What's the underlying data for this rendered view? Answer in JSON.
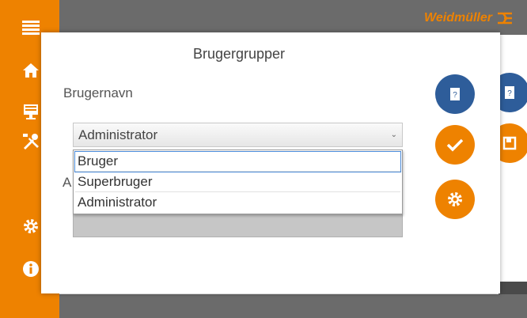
{
  "brand": {
    "name": "Weidmüller"
  },
  "dialog": {
    "title": "Brugergrupper",
    "username_label": "Brugernavn",
    "second_label_visible": "A"
  },
  "select": {
    "value": "Administrator",
    "options": [
      "Bruger",
      "Superbruger",
      "Administrator"
    ],
    "highlighted": "Bruger"
  },
  "colors": {
    "accent_orange": "#ee8200",
    "button_blue": "#2e5d9a",
    "bar_gray": "#6b6b6b"
  },
  "icons": {
    "sidebar": [
      "menu-icon",
      "home-icon",
      "monitor-icon",
      "tools-icon",
      "gear-icon",
      "info-icon"
    ],
    "dialog_buttons": [
      "help-book-icon",
      "checkmark-icon",
      "gear-icon"
    ],
    "background_buttons": [
      "help-book-icon",
      "save-icon",
      "list-icon"
    ]
  }
}
